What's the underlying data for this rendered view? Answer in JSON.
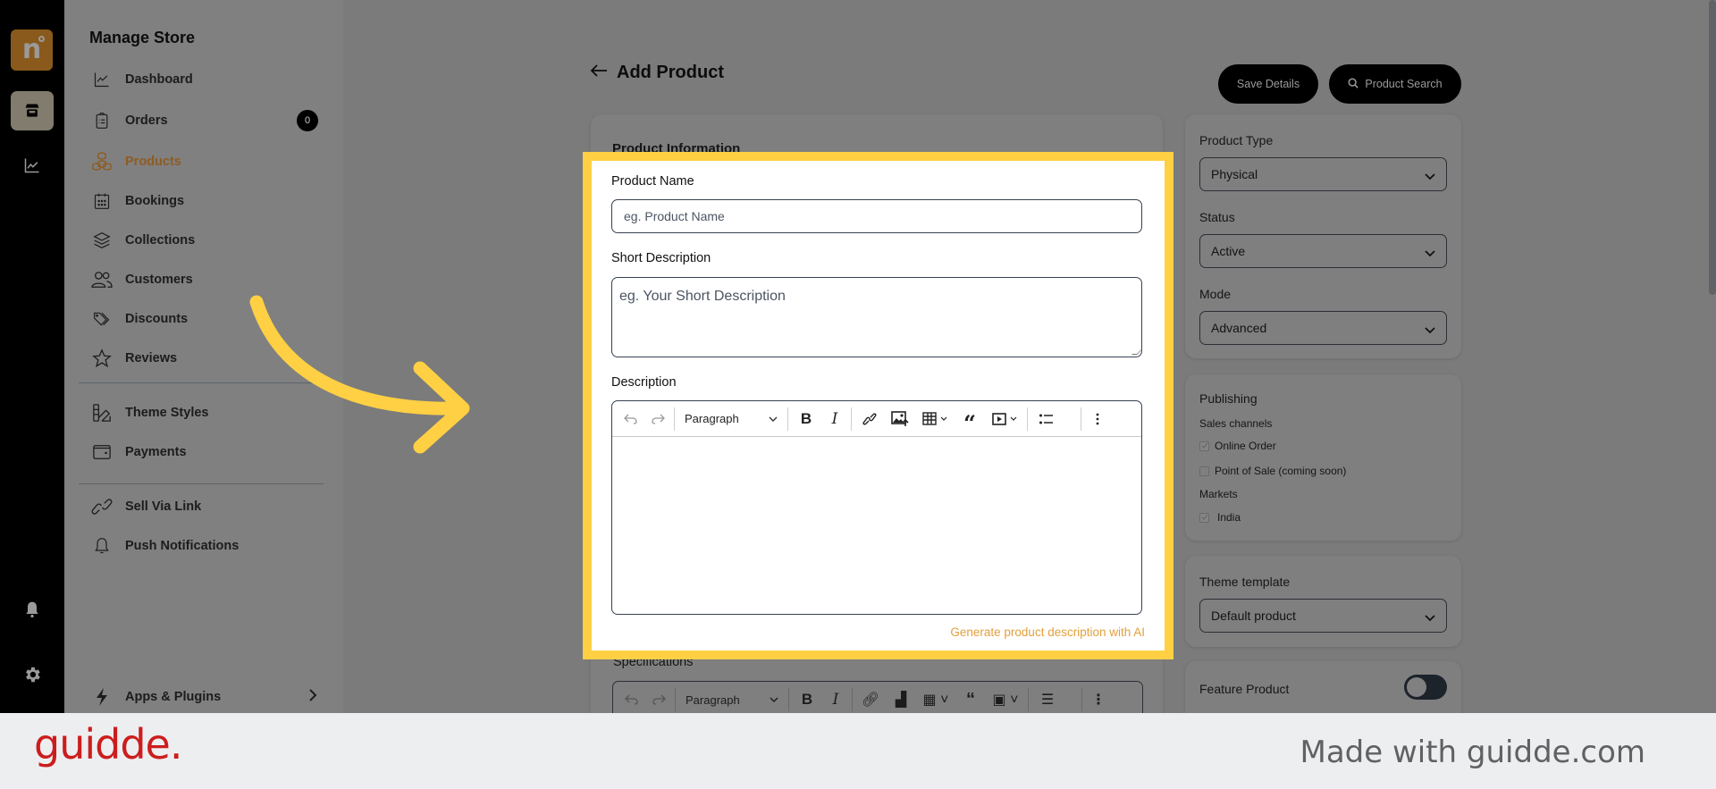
{
  "sidebar": {
    "title": "Manage Store",
    "items": [
      {
        "label": "Dashboard",
        "icon": "chart-line-icon"
      },
      {
        "label": "Orders",
        "icon": "clipboard-icon",
        "badge": "0"
      },
      {
        "label": "Products",
        "icon": "boxes-icon",
        "active": true
      },
      {
        "label": "Bookings",
        "icon": "calendar-icon"
      },
      {
        "label": "Collections",
        "icon": "layers-icon"
      },
      {
        "label": "Customers",
        "icon": "users-icon"
      },
      {
        "label": "Discounts",
        "icon": "tags-icon"
      },
      {
        "label": "Reviews",
        "icon": "star-icon"
      },
      {
        "label": "Theme Styles",
        "icon": "swatch-icon"
      },
      {
        "label": "Payments",
        "icon": "wallet-icon"
      },
      {
        "label": "Sell Via Link",
        "icon": "link-icon"
      },
      {
        "label": "Push Notifications",
        "icon": "bell-icon"
      },
      {
        "label": "Apps & Plugins",
        "icon": "bolt-icon"
      }
    ]
  },
  "rail": {
    "logo": "n",
    "icons": [
      "store-icon",
      "chart-icon",
      "bell-icon",
      "gear-icon"
    ]
  },
  "header": {
    "title": "Add Product",
    "save_label": "Save Details",
    "search_label": "Product Search"
  },
  "form": {
    "section_title": "Product Information",
    "product_name_label": "Product Name",
    "product_name_placeholder": "eg. Product Name",
    "short_desc_label": "Short Description",
    "short_desc_placeholder": "eg. Your Short Description",
    "description_label": "Description",
    "paragraph_label": "Paragraph",
    "ai_link": "Generate product description with AI",
    "specifications_label": "Specifications"
  },
  "right_panel": {
    "product_type_label": "Product Type",
    "product_type_value": "Physical",
    "status_label": "Status",
    "status_value": "Active",
    "mode_label": "Mode",
    "mode_value": "Advanced",
    "publishing_title": "Publishing",
    "sales_channels_label": "Sales channels",
    "channels": [
      {
        "label": "Online Order",
        "checked": true
      },
      {
        "label": "Point of Sale (coming soon)",
        "checked": false
      }
    ],
    "markets_label": "Markets",
    "markets": [
      {
        "label": "India",
        "checked": true
      }
    ],
    "theme_template_label": "Theme template",
    "theme_template_value": "Default product",
    "feature_product_label": "Feature Product",
    "feature_product_on": false
  },
  "footer": {
    "brand": "guidde.",
    "made_with": "Made with guidde.com"
  },
  "colors": {
    "highlight": "#ffd043",
    "active_nav": "#8d5c22",
    "ai_link": "#e2a03c",
    "brand_red": "#cc1d1d"
  }
}
